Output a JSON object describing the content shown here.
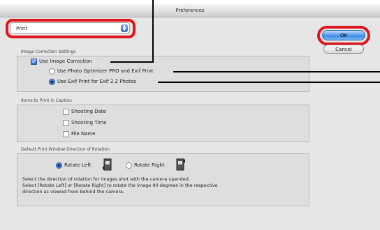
{
  "window": {
    "title": "Preferences"
  },
  "popup": {
    "selected": "Print"
  },
  "buttons": {
    "ok": "OK",
    "cancel": "Cancel"
  },
  "image_correction": {
    "group_title": "Image Correction Settings",
    "use_image_correction": {
      "label": "Use Image Correction",
      "checked": true
    },
    "options": [
      {
        "label": "Use Photo Optimizer PRO and Exif Print",
        "selected": false
      },
      {
        "label": "Use Exif Print for Exif 2.2 Photos",
        "selected": true
      }
    ]
  },
  "caption": {
    "group_title": "Items to Print in Caption",
    "items": [
      {
        "label": "Shooting Date",
        "checked": false
      },
      {
        "label": "Shooting Time",
        "checked": false
      },
      {
        "label": "File Name",
        "checked": false
      }
    ]
  },
  "rotation": {
    "group_title": "Default Print Window Direction of Rotation",
    "options": [
      {
        "label": "Rotate Left",
        "selected": true,
        "icon": "rotate-left-icon"
      },
      {
        "label": "Rotate Right",
        "selected": false,
        "icon": "rotate-right-icon"
      }
    ],
    "description": [
      "Select the direction of rotation for images shot with the camera upended.",
      "Select [Rotate Left] or [Rotate Right] to rotate the image 90 degrees in the respective",
      "direction as viewed from behind the camera."
    ]
  },
  "colors": {
    "annotation_ring": "#e0141b",
    "accent_blue": "#2a62c8"
  }
}
